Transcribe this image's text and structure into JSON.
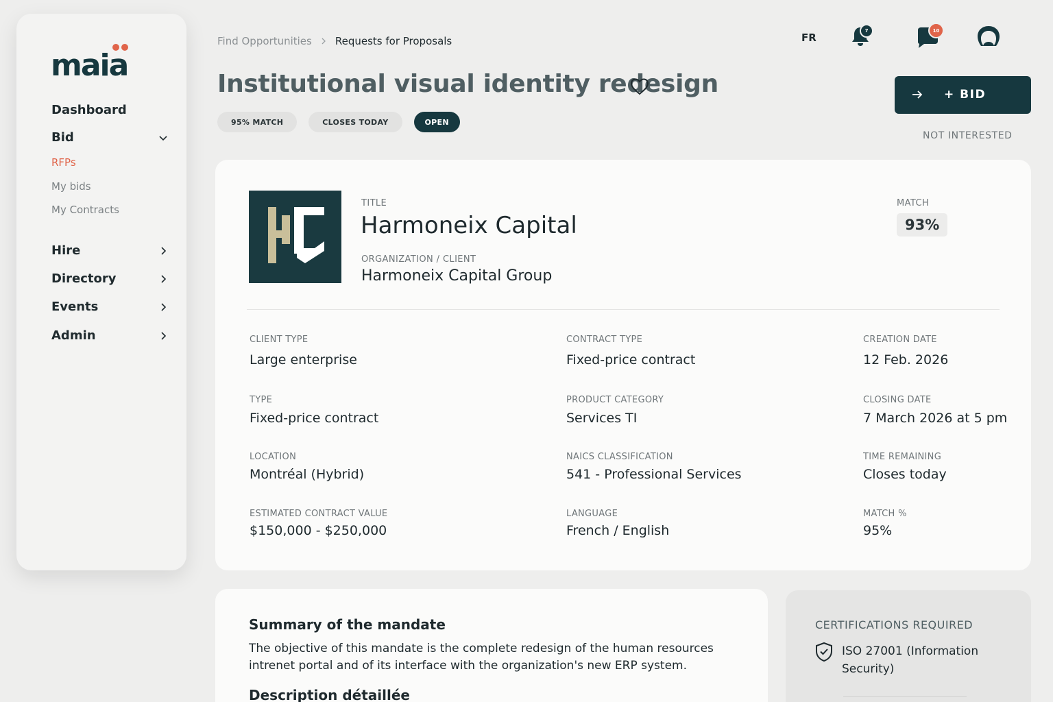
{
  "sidebar": {
    "brand": "maia",
    "items": [
      {
        "label": "Dashboard"
      },
      {
        "label": "Bid",
        "expanded": true,
        "children": [
          {
            "label": "RFPs",
            "active": true
          },
          {
            "label": "My bids"
          },
          {
            "label": "My Contracts"
          }
        ]
      },
      {
        "label": "Hire"
      },
      {
        "label": "Directory"
      },
      {
        "label": "Events"
      },
      {
        "label": "Admin"
      }
    ]
  },
  "header": {
    "breadcrumb": [
      "Find Opportunities",
      "Requests for Proposals"
    ],
    "language": "FR",
    "notifications_badge": "7",
    "messages_badge": "10",
    "icons": [
      "bell-icon",
      "chat-icon",
      "user-icon"
    ]
  },
  "opportunity": {
    "title": "Institutional visual identity redesign",
    "tags": [
      "95% MATCH",
      "CLOSES TODAY",
      "OPEN"
    ],
    "bid_label": "+ BID",
    "not_interested_label": "NOT INTERESTED"
  },
  "card": {
    "title_label": "TITLE",
    "title_value": "Harmoneix Capital",
    "org_label": "ORGANIZATION / CLIENT",
    "org_value": "Harmoneix Capital Group",
    "match_label": "MATCH",
    "match_value": "93%",
    "fields": [
      {
        "label": "CLIENT TYPE",
        "value": "Large enterprise"
      },
      {
        "label": "CONTRACT TYPE",
        "value": "Fixed-price contract"
      },
      {
        "label": "CREATION DATE",
        "value": "12 Feb. 2026"
      },
      {
        "label": "TYPE",
        "value": "Fixed-price contract"
      },
      {
        "label": "PRODUCT CATEGORY",
        "value": "Services TI"
      },
      {
        "label": "CLOSING DATE",
        "value": "7 March 2026 at 5 pm"
      },
      {
        "label": "LOCATION",
        "value": "Montréal (Hybrid)"
      },
      {
        "label": "NAICS CLASSIFICATION",
        "value": "541 - Professional Services"
      },
      {
        "label": "TIME REMAINING",
        "value": "Closes today"
      },
      {
        "label": "ESTIMATED CONTRACT VALUE",
        "value": "$150,000 - $250,000"
      },
      {
        "label": "LANGUAGE",
        "value": "French / English"
      },
      {
        "label": "MATCH %",
        "value": "95%"
      }
    ]
  },
  "summary": {
    "title": "Summary of the mandate",
    "text": "The objective of this mandate is  the complete redesign of the human resources intrenet portal and of its interface with the organization's new ERP system.",
    "description_title": "Description détaillée"
  },
  "certifications": {
    "title": "CERTIFICATIONS REQUIRED",
    "items": [
      "ISO 27001 (Information Security)"
    ]
  },
  "colors": {
    "accent": "#16383f",
    "active_nav": "#e0644a",
    "badge_red": "#e0644a"
  }
}
